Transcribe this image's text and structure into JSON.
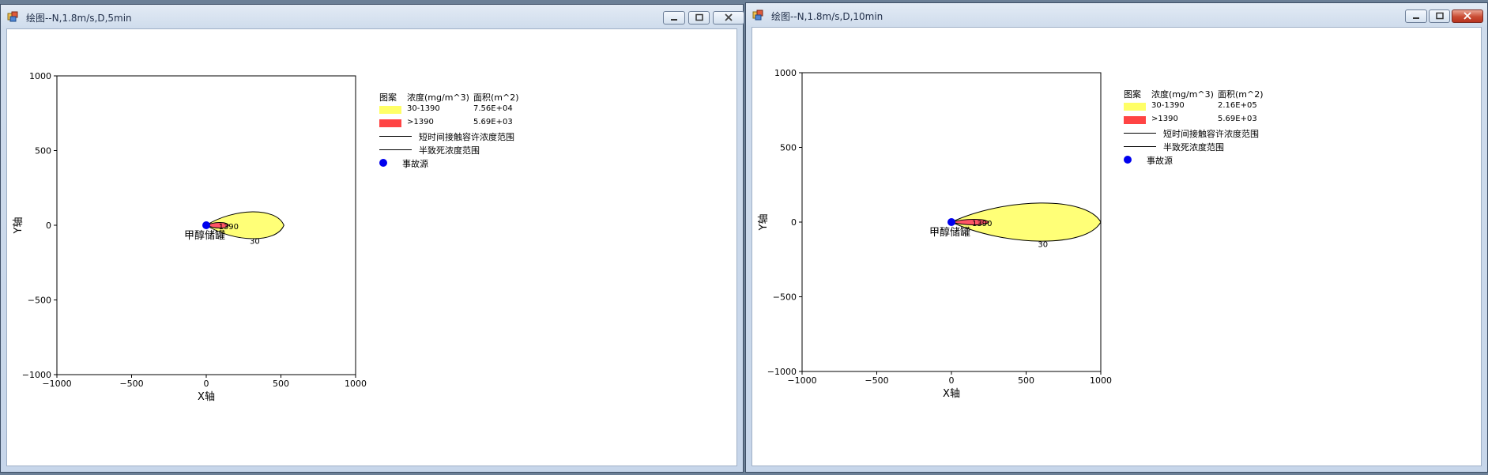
{
  "windows": [
    {
      "title": "绘图--N,1.8m/s,D,5min",
      "close_style": "normal",
      "plot": {
        "plume": {
          "yellow_end_x": 520,
          "yellow_half_width": 120,
          "red_end_x": 150,
          "red_half_width": 25
        },
        "contour_labels": {
          "outer": "30",
          "inner": "1390"
        },
        "source_label": "甲醇储罐"
      },
      "legend": {
        "header": {
          "pattern": "图案",
          "concentration": "浓度(mg/m^3)",
          "area": "面积(m^2)"
        },
        "rows": [
          {
            "swatch": "yellow",
            "range": "30-1390",
            "value": "7.56E+04"
          },
          {
            "swatch": "red",
            "range": ">1390",
            "value": "5.69E+03"
          }
        ],
        "line1": "短时间接触容许浓度范围",
        "line2": "半致死浓度范围",
        "dot": "事故源"
      }
    },
    {
      "title": "绘图--N,1.8m/s,D,10min",
      "close_style": "red",
      "plot": {
        "plume": {
          "yellow_end_x": 1000,
          "yellow_half_width": 170,
          "red_end_x": 250,
          "red_half_width": 25
        },
        "contour_labels": {
          "outer": "30",
          "inner": "1390"
        },
        "source_label": "甲醇储罐"
      },
      "legend": {
        "header": {
          "pattern": "图案",
          "concentration": "浓度(mg/m^3)",
          "area": "面积(m^2)"
        },
        "rows": [
          {
            "swatch": "yellow",
            "range": "30-1390",
            "value": "2.16E+05"
          },
          {
            "swatch": "red",
            "range": ">1390",
            "value": "5.69E+03"
          }
        ],
        "line1": "短时间接触容许浓度范围",
        "line2": "半致死浓度范围",
        "dot": "事故源"
      }
    }
  ],
  "axes": {
    "xlabel": "X轴",
    "ylabel": "Y轴",
    "xlim": [
      -1000,
      1000
    ],
    "ylim": [
      -1000,
      1000
    ],
    "ticks": [
      -1000,
      -500,
      0,
      500,
      1000
    ],
    "tick_labels": [
      "−1000",
      "−500",
      "0",
      "500",
      "1000"
    ]
  },
  "colors": {
    "zone_30_1390": "#ffff77",
    "zone_over_1390": "#ff5566",
    "source": "#0000ee"
  }
}
